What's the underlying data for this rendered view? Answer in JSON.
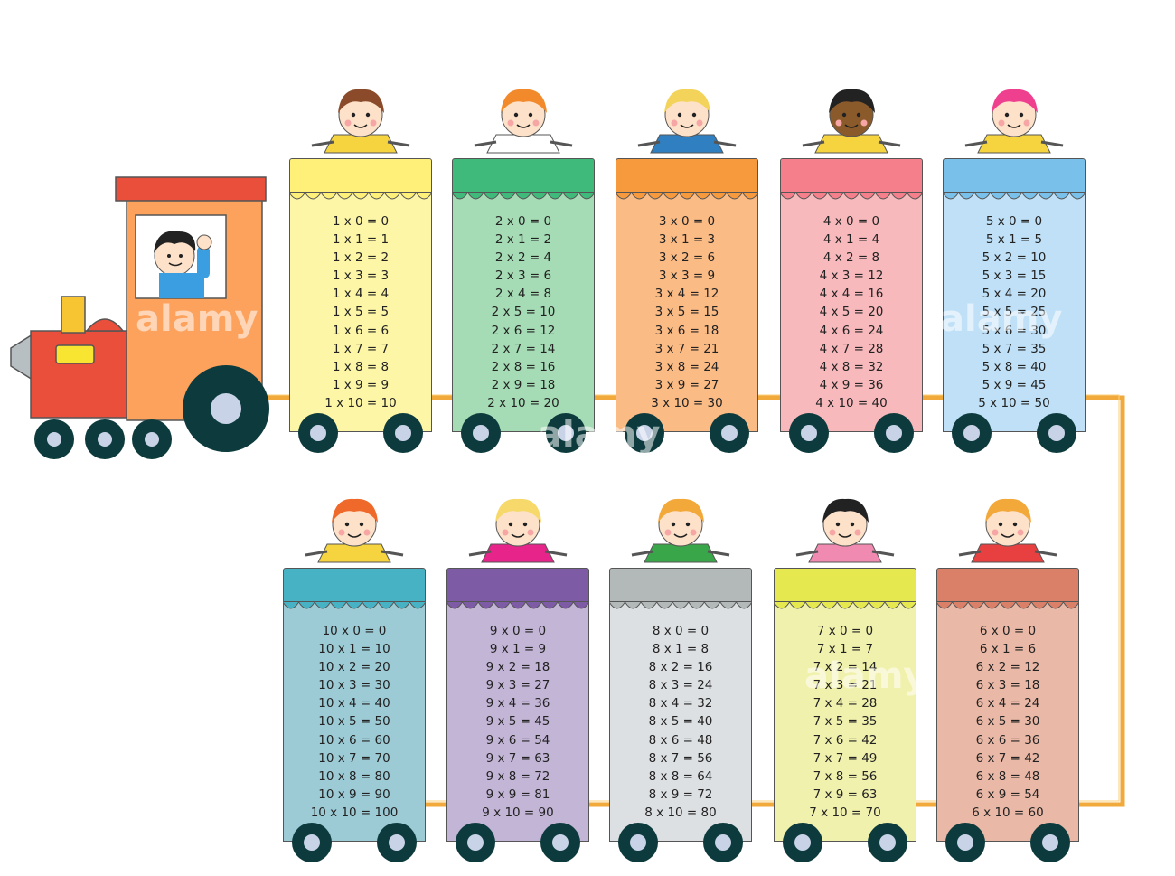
{
  "watermark": "alamy",
  "colors": {
    "track": "#f2a93b",
    "wheel": "#0d3b3d",
    "hub": "#c9d3e8"
  },
  "tables": [
    {
      "factor": 1,
      "roof": "#fff07a",
      "body": "#fdf6a6",
      "lines": [
        "1 x 0 = 0",
        "1 x 1 = 1",
        "1 x 2 = 2",
        "1 x 3 = 3",
        "1 x 4 = 4",
        "1 x 5 = 5",
        "1 x 6 = 6",
        "1 x 7 = 7",
        "1 x 8 = 8",
        "1 x 9 = 9",
        "1 x 10 = 10"
      ]
    },
    {
      "factor": 2,
      "roof": "#3fba7a",
      "body": "#a6dcb5",
      "lines": [
        "2 x 0 = 0",
        "2 x 1 = 2",
        "2 x 2 = 4",
        "2 x 3 = 6",
        "2 x 4 = 8",
        "2 x 5 = 10",
        "2 x 6 = 12",
        "2 x 7 = 14",
        "2 x 8 = 16",
        "2 x 9 = 18",
        "2 x 10 = 20"
      ]
    },
    {
      "factor": 3,
      "roof": "#f79a3e",
      "body": "#fbbb85",
      "lines": [
        "3 x 0 = 0",
        "3 x 1 = 3",
        "3 x 2 = 6",
        "3 x 3 = 9",
        "3 x 4 = 12",
        "3 x 5 = 15",
        "3 x 6 = 18",
        "3 x 7 = 21",
        "3 x 8 = 24",
        "3 x 9 = 27",
        "3 x 10 = 30"
      ]
    },
    {
      "factor": 4,
      "roof": "#f57f8a",
      "body": "#f7b9bc",
      "lines": [
        "4 x 0 = 0",
        "4 x 1 = 4",
        "4 x 2 = 8",
        "4 x 3 = 12",
        "4 x 4 = 16",
        "4 x 5 = 20",
        "4 x 6 = 24",
        "4 x 7 = 28",
        "4 x 8 = 32",
        "4 x 9 = 36",
        "4 x 10 = 40"
      ]
    },
    {
      "factor": 5,
      "roof": "#79c0ea",
      "body": "#bfe0f6",
      "lines": [
        "5 x 0 = 0",
        "5 x 1 = 5",
        "5 x 2 = 10",
        "5 x 3 = 15",
        "5 x 4 = 20",
        "5 x 5 = 25",
        "5 x 6 = 30",
        "5 x 7 = 35",
        "5 x 8 = 40",
        "5 x 9 = 45",
        "5 x 10 = 50"
      ]
    },
    {
      "factor": 10,
      "roof": "#46b2c4",
      "body": "#9ccbd6",
      "lines": [
        "10 x 0 = 0",
        "10 x 1 = 10",
        "10 x 2 = 20",
        "10 x 3 = 30",
        "10 x 4 = 40",
        "10 x 5 = 50",
        "10 x 6 = 60",
        "10 x 7 = 70",
        "10 x 8 = 80",
        "10 x 9 = 90",
        "10 x 10 = 100"
      ]
    },
    {
      "factor": 9,
      "roof": "#7d5ba5",
      "body": "#c3b5d6",
      "lines": [
        "9 x 0 = 0",
        "9 x 1 = 9",
        "9 x 2 = 18",
        "9 x 3 = 27",
        "9 x 4 = 36",
        "9 x 5 = 45",
        "9 x 6 = 54",
        "9 x 7 = 63",
        "9 x 8 = 72",
        "9 x 9 = 81",
        "9 x 10 = 90"
      ]
    },
    {
      "factor": 8,
      "roof": "#b3b9b9",
      "body": "#dde0e3",
      "lines": [
        "8 x 0 = 0",
        "8 x 1 = 8",
        "8 x 2 = 16",
        "8 x 3 = 24",
        "8 x 4 = 32",
        "8 x 5 = 40",
        "8 x 6 = 48",
        "8 x 7 = 56",
        "8 x 8 = 64",
        "8 x 9 = 72",
        "8 x 10 = 80"
      ]
    },
    {
      "factor": 7,
      "roof": "#e5e84e",
      "body": "#f1f1ae",
      "lines": [
        "7 x 0 = 0",
        "7 x 1 = 7",
        "7 x 2 = 14",
        "7 x 3 = 21",
        "7 x 4 = 28",
        "7 x 5 = 35",
        "7 x 6 = 42",
        "7 x 7 = 49",
        "7 x 8 = 56",
        "7 x 9 = 63",
        "7 x 10 = 70"
      ]
    },
    {
      "factor": 6,
      "roof": "#db8068",
      "body": "#e9b8a6",
      "lines": [
        "6 x 0 = 0",
        "6 x 1 = 6",
        "6 x 2 = 12",
        "6 x 3 = 18",
        "6 x 4 = 24",
        "6 x 5 = 30",
        "6 x 6 = 36",
        "6 x 7 = 42",
        "6 x 8 = 48",
        "6 x 9 = 54",
        "6 x 10 = 60"
      ]
    }
  ]
}
